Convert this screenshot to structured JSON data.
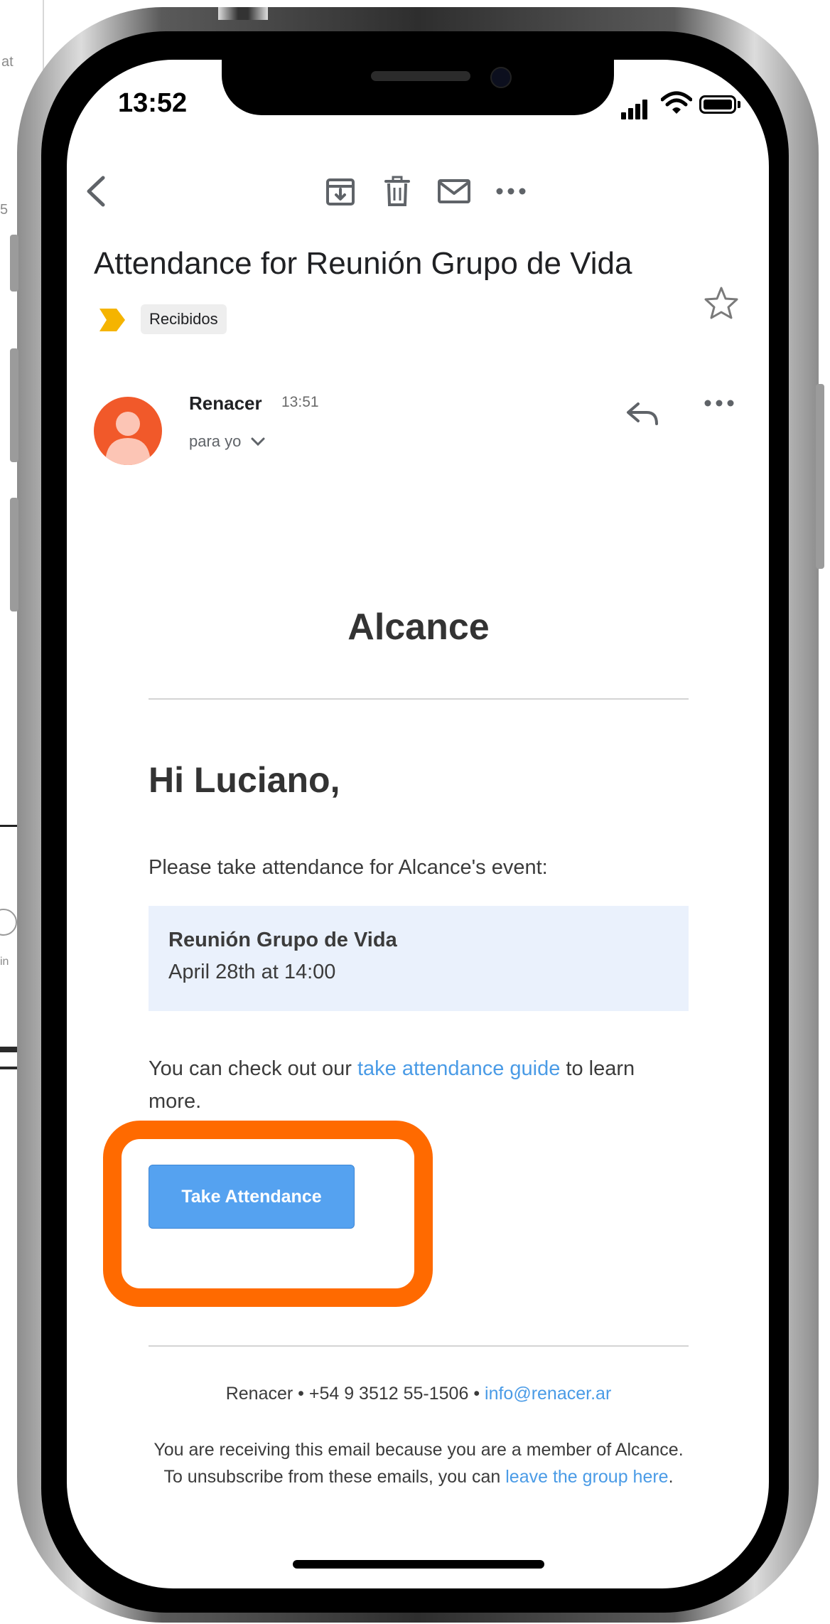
{
  "status_bar": {
    "time": "13:52"
  },
  "background_window": {
    "frag1": "at",
    "frag2": "5",
    "frag3": "in"
  },
  "email": {
    "subject": "Attendance for Reunión Grupo de Vida",
    "label": "Recibidos",
    "sender": "Renacer",
    "time": "13:51",
    "recipient": "para yo"
  },
  "body": {
    "brand": "Alcance",
    "greeting": "Hi Luciano,",
    "intro": "Please take attendance for Alcance's event:",
    "event_name": "Reunión Grupo de Vida",
    "event_date": "April 28th at 14:00",
    "guide_prefix": "You can check out our ",
    "guide_link": "take attendance guide",
    "guide_suffix": " to learn more.",
    "cta_label": "Take Attendance",
    "footer_contact_prefix": "Renacer • +54 9 3512 55-1506 • ",
    "footer_email": "info@renacer.ar",
    "footer_note_prefix": "You are receiving this email because you are a member of Alcance. To unsubscribe from these emails, you can ",
    "footer_note_link": "leave the group here",
    "footer_note_suffix": "."
  },
  "colors": {
    "accent_link": "#4a9be6",
    "cta": "#55a2f0",
    "highlight": "#ff6a00",
    "avatar": "#f1592a",
    "event_card_bg": "#eaf1fc",
    "label_chevron": "#f5b400"
  },
  "icons": [
    "back-icon",
    "archive-icon",
    "trash-icon",
    "mail-icon",
    "more-icon",
    "label-chevron-icon",
    "star-icon",
    "reply-icon",
    "chevron-down-icon",
    "signal-icon",
    "wifi-icon",
    "battery-icon",
    "avatar-person-icon"
  ]
}
